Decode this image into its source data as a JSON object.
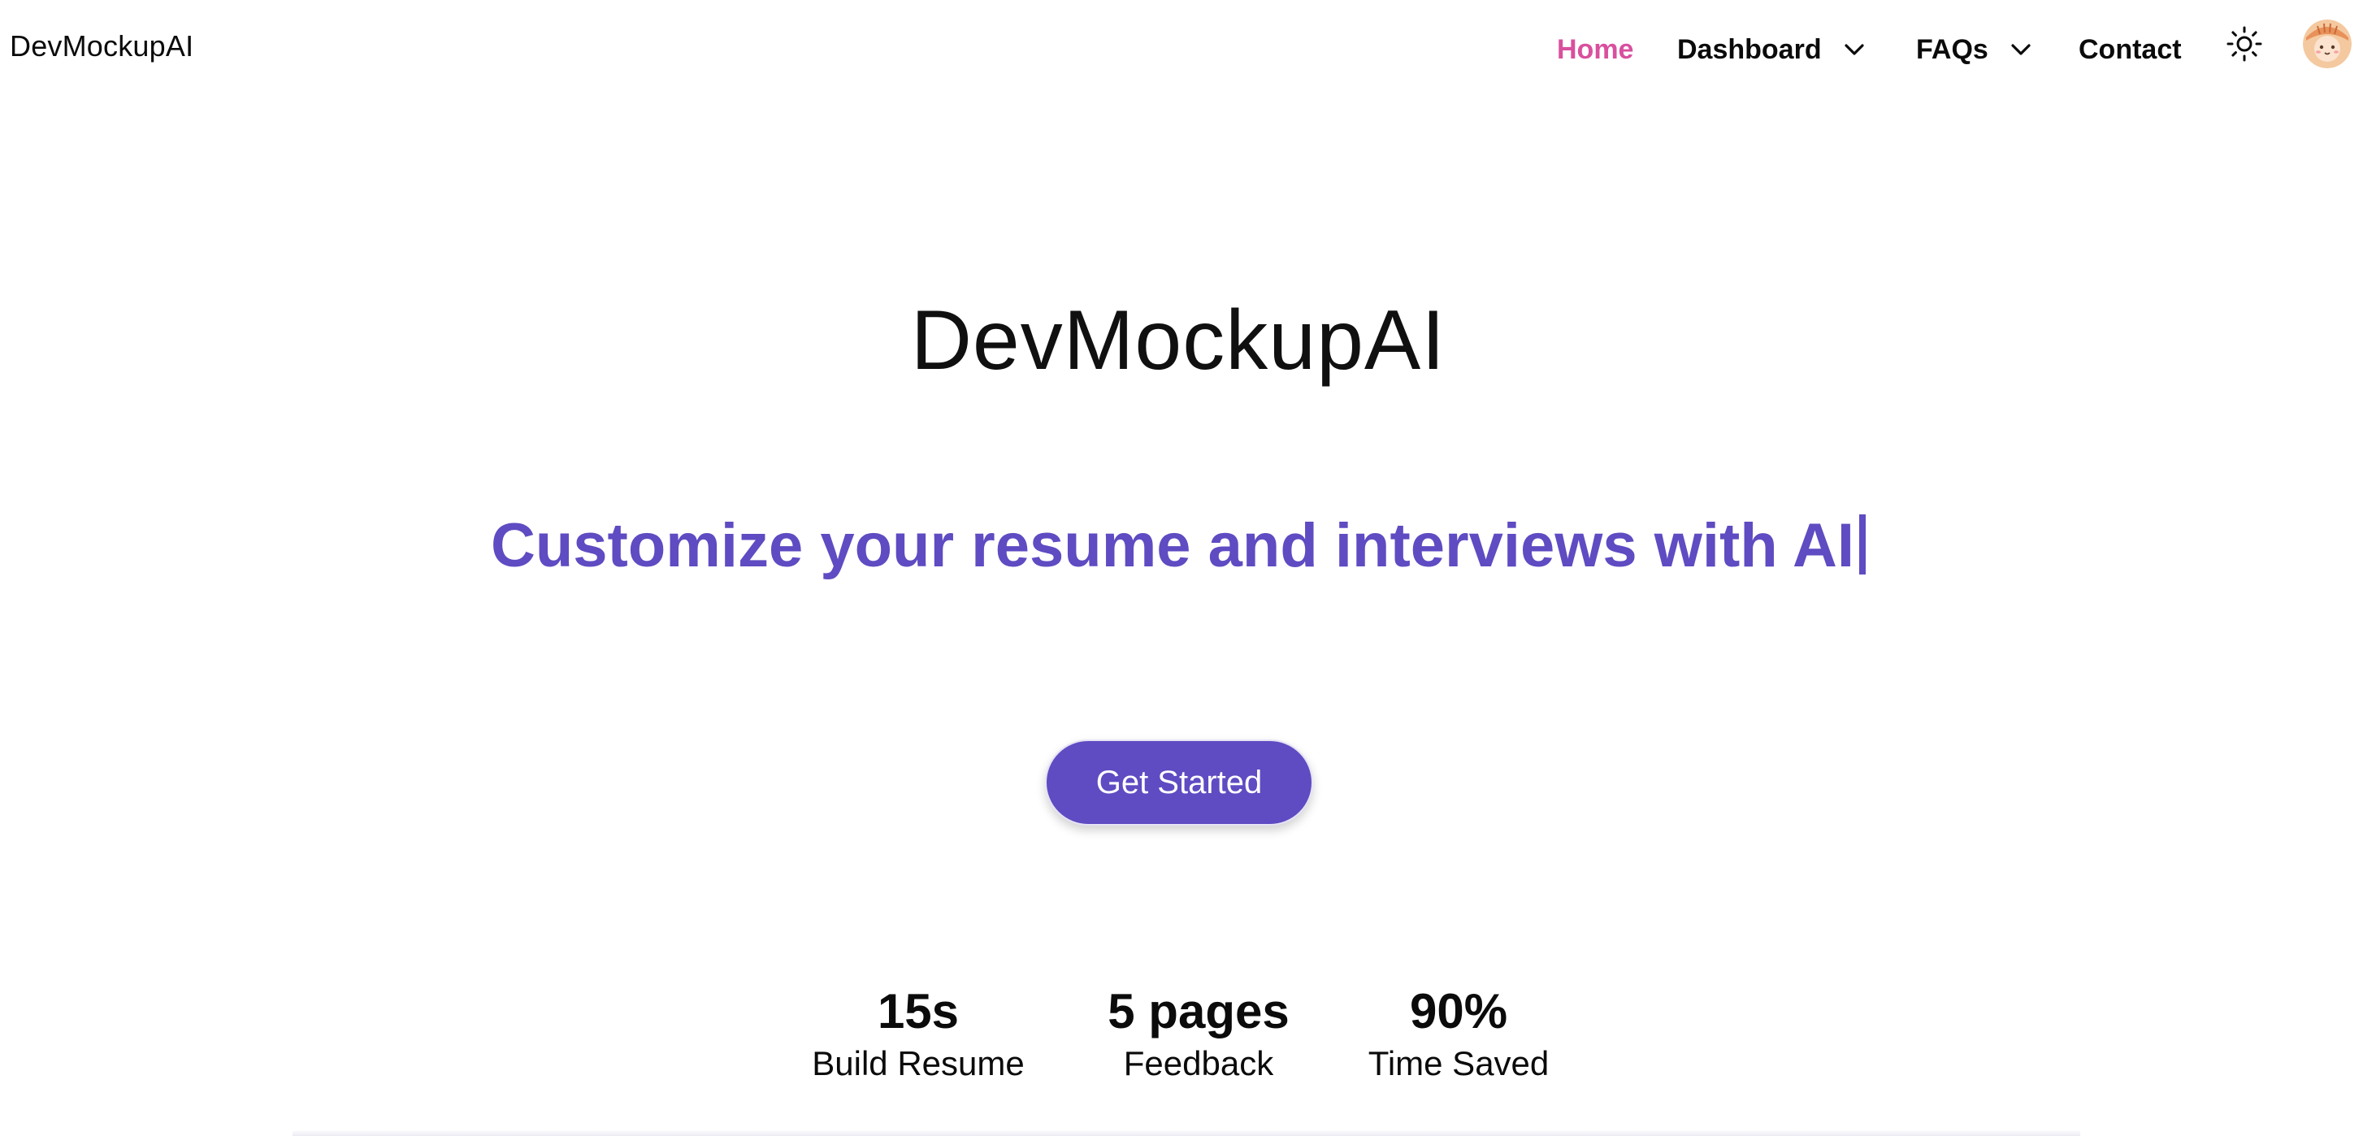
{
  "nav": {
    "brand": "DevMockupAI",
    "items": [
      {
        "label": "Home",
        "active": true
      },
      {
        "label": "Dashboard",
        "has_dropdown": true
      },
      {
        "label": "FAQs",
        "has_dropdown": true
      },
      {
        "label": "Contact"
      }
    ],
    "theme_icon": "sun-icon",
    "avatar_icon": "avatar"
  },
  "hero": {
    "title": "DevMockupAI",
    "subtitle": "Customize your resume and interviews with AI",
    "cta_label": "Get Started"
  },
  "stats": [
    {
      "value": "15s",
      "label": "Build Resume"
    },
    {
      "value": "5 pages",
      "label": "Feedback"
    },
    {
      "value": "90%",
      "label": "Time Saved"
    }
  ],
  "colors": {
    "accent": "#5f4bc2",
    "active_nav": "#d94f9e",
    "text": "#0b0b0b",
    "background": "#ffffff"
  }
}
